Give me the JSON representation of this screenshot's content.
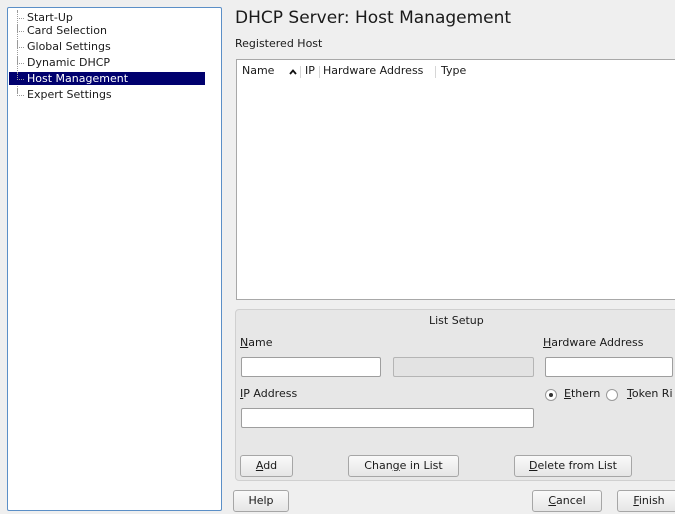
{
  "sidebar": {
    "items": [
      {
        "label": "Start-Up"
      },
      {
        "label": "Card Selection"
      },
      {
        "label": "Global Settings"
      },
      {
        "label": "Dynamic DHCP"
      },
      {
        "label": "Host Management",
        "selected": true
      },
      {
        "label": "Expert Settings"
      }
    ]
  },
  "main": {
    "title": "DHCP Server: Host Management",
    "subtitle": "Registered Host",
    "table": {
      "columns": [
        "Name",
        "IP",
        "Hardware Address",
        "Type"
      ],
      "sort_column": "Name",
      "sort_direction": "ascending",
      "rows": []
    }
  },
  "list_setup": {
    "title": "List Setup",
    "name_label": {
      "accel": "N",
      "rest": "ame"
    },
    "name_value": "",
    "middle_value": "",
    "ip_label": {
      "accel": "I",
      "rest": "P Address"
    },
    "ip_value": "",
    "hw_label": {
      "accel": "H",
      "rest": "ardware Address"
    },
    "hw_value": "",
    "hw_type": {
      "selected": "Ethernet",
      "ethernet": {
        "accel": "E",
        "rest": "thern"
      },
      "token": {
        "accel": "T",
        "rest": "oken Ri"
      }
    },
    "buttons": {
      "add": {
        "accel": "A",
        "rest": "dd"
      },
      "change": {
        "pre": "Chan",
        "accel": "g",
        "rest": "e in List"
      },
      "delete": {
        "accel": "D",
        "rest": "elete from List"
      }
    }
  },
  "footer": {
    "help": "Help",
    "cancel": {
      "accel": "C",
      "rest": "ancel"
    },
    "finish": {
      "accel": "F",
      "rest": "inish"
    }
  },
  "colors": {
    "selection": "#00006e",
    "tree_border": "#5b8fc7"
  }
}
